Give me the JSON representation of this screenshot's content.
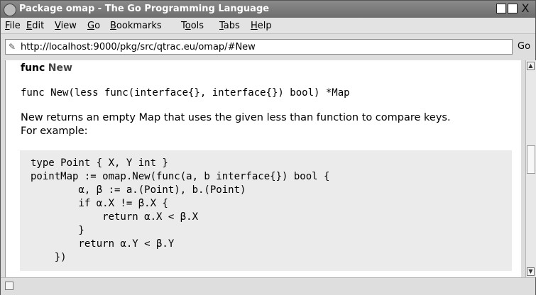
{
  "window": {
    "title": "Package omap - The Go Programming Language",
    "close_glyph": "X"
  },
  "menubar": {
    "items": [
      {
        "label": "File",
        "underline": "F",
        "rest": "ile"
      },
      {
        "label": "Edit",
        "underline": "E",
        "rest": "dit"
      },
      {
        "label": "View",
        "underline": "V",
        "rest": "iew"
      },
      {
        "label": "Go",
        "underline": "G",
        "rest": "o"
      },
      {
        "label": "Bookmarks",
        "underline": "B",
        "rest": "ookmarks"
      },
      {
        "label": "Tools",
        "pre": "T",
        "underline": "o",
        "rest": "ols"
      },
      {
        "label": "Tabs",
        "underline": "T",
        "rest": "abs"
      },
      {
        "label": "Help",
        "underline": "H",
        "rest": "elp"
      }
    ]
  },
  "navbar": {
    "url": "http://localhost:9000/pkg/src/qtrac.eu/omap/#New",
    "go_label": "Go"
  },
  "page": {
    "heading_keyword": "func",
    "heading_name": "New",
    "signature": "func New(less func(interface{}, interface{}) bool) *Map",
    "description_line1": "New returns an empty Map that uses the given less than function to compare keys.",
    "description_line2": "For example:",
    "code_lines": [
      "type Point { X, Y int }",
      "pointMap := omap.New(func(a, b interface{}) bool {",
      "        α, β := a.(Point), b.(Point)",
      "        if α.X != β.X {",
      "            return α.X < β.X",
      "        }",
      "        return α.Y < β.Y",
      "    })"
    ]
  },
  "icons": {
    "app": "app-icon",
    "url_page": "page-icon",
    "status": "status-icon"
  }
}
